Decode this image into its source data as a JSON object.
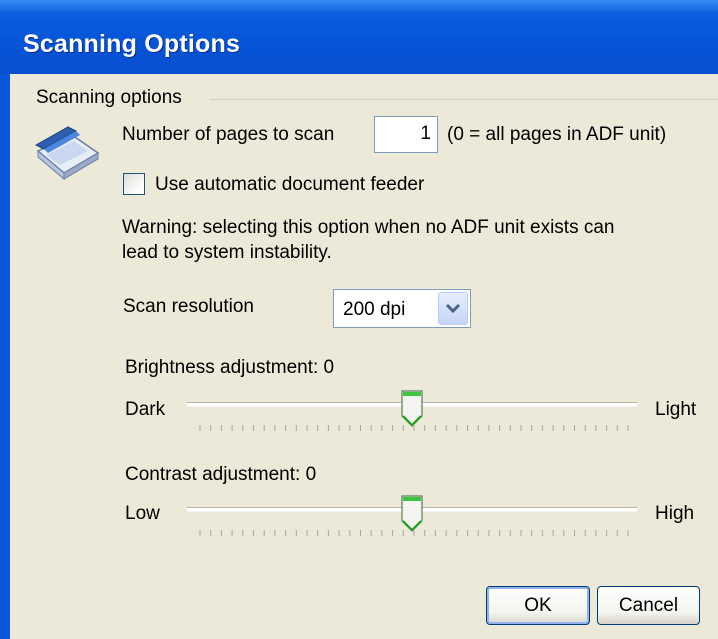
{
  "window": {
    "title": "Scanning Options"
  },
  "group": {
    "label": "Scanning options"
  },
  "pages": {
    "label": "Number of pages to scan",
    "value": "1",
    "hint": "(0 = all pages in ADF unit)"
  },
  "adf": {
    "checkbox_label": "Use automatic document feeder",
    "checked": false,
    "warning_line1": "Warning: selecting this option when no ADF unit exists can",
    "warning_line2": "lead to system instability."
  },
  "resolution": {
    "label": "Scan resolution",
    "selected": "200 dpi"
  },
  "brightness": {
    "label": "Brightness adjustment: 0",
    "min_label": "Dark",
    "max_label": "Light",
    "level": 0.5
  },
  "contrast": {
    "label": "Contrast adjustment: 0",
    "min_label": "Low",
    "max_label": "High",
    "level": 0.5
  },
  "buttons": {
    "ok": "OK",
    "cancel": "Cancel"
  },
  "icons": {
    "scanner": "scanner-icon",
    "dropdown": "chevron-down-icon"
  },
  "colors": {
    "titlebar": "#0553d6",
    "dialog_bg": "#ece9d8",
    "thumb_green": "#21a121"
  }
}
